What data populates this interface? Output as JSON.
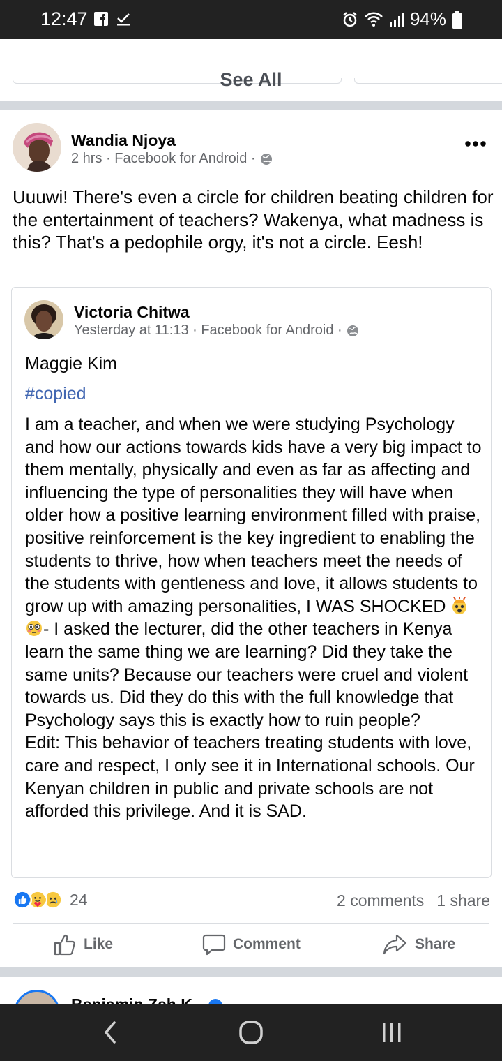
{
  "status_bar": {
    "time": "12:47",
    "battery": "94%"
  },
  "feed": {
    "see_all": "See All"
  },
  "post": {
    "author": "Wandia Njoya",
    "meta": "2 hrs · Facebook for Android ·",
    "text": "Uuuwi! There's even a circle for children beating children for the entertainment of teachers? Wakenya, what madness is this? That's a pedophile orgy, it's not a circle. Eesh!",
    "shared": {
      "author": "Victoria Chitwa",
      "meta": "Yesterday at 11:13 · Facebook for Android ·",
      "line1": "Maggie Kim",
      "hashtag": "#copied",
      "body_part1": "I am a teacher, and when we were studying Psychology and how our actions towards kids have a very big impact to them mentally, physically and even as far as affecting and influencing the type of personalities they will have when older how a positive learning environment filled with praise, positive reinforcement is the key ingredient to enabling the students to thrive, how when teachers meet the needs of the students with gentleness and love, it allows students to grow up with amazing personalities, I WAS SHOCKED ",
      "body_part2": "- I asked the lecturer, did the other teachers in Kenya learn the same thing we are learning? Did they take the same units? Because our teachers were cruel and violent towards us. Did they do this with the full knowledge that Psychology says this is exactly how to ruin people?\nEdit: This behavior of teachers treating students with love, care and respect, I only see it in International schools. Our Kenyan children in public and private schools are not afforded this privilege. And it is SAD."
    },
    "reaction_count": "24",
    "comments": "2 comments",
    "shares": "1 share",
    "actions": {
      "like": "Like",
      "comment": "Comment",
      "share": "Share"
    }
  },
  "next_post": {
    "author": "Benjamin Zeh K"
  },
  "colors": {
    "status_bar": "#222222",
    "link": "#4267b2",
    "like_blue": "#1877f2",
    "muted": "#65676b"
  }
}
